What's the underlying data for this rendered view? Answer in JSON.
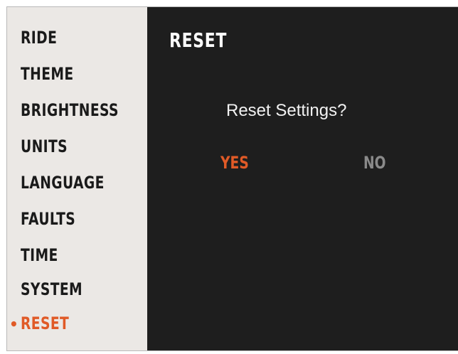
{
  "sidebar": {
    "items": [
      {
        "label": "RIDE"
      },
      {
        "label": "THEME"
      },
      {
        "label": "BRIGHTNESS"
      },
      {
        "label": "UNITS"
      },
      {
        "label": "LANGUAGE"
      },
      {
        "label": "FAULTS"
      },
      {
        "label": "TIME"
      },
      {
        "label": "SYSTEM"
      },
      {
        "label": "RESET"
      }
    ],
    "active_index": 8,
    "active_marker": "•"
  },
  "panel": {
    "title": "RESET",
    "question": "Reset Settings?",
    "yes_label": "YES",
    "no_label": "NO"
  },
  "colors": {
    "accent": "#e05a27",
    "panel_bg": "#1e1e1e",
    "sidebar_bg": "#ebe8e5",
    "inactive_option": "#8a8a8a"
  }
}
